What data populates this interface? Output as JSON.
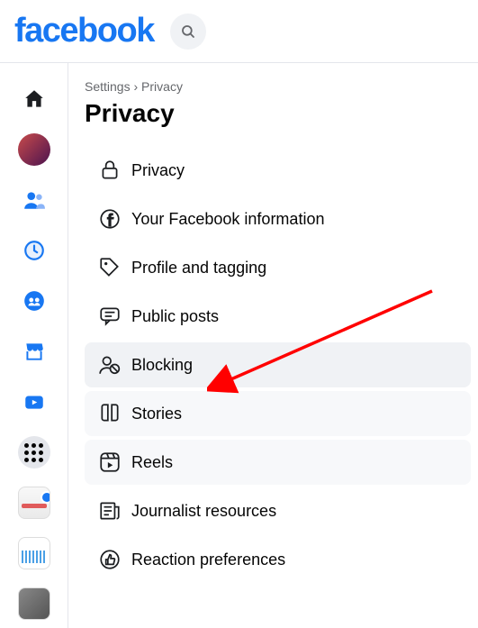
{
  "header": {
    "logo_text": "facebook"
  },
  "breadcrumb": {
    "root": "Settings",
    "sep": "›",
    "current": "Privacy"
  },
  "page": {
    "title": "Privacy"
  },
  "menu": {
    "items": [
      {
        "label": "Privacy"
      },
      {
        "label": "Your Facebook information"
      },
      {
        "label": "Profile and tagging"
      },
      {
        "label": "Public posts"
      },
      {
        "label": "Blocking"
      },
      {
        "label": "Stories"
      },
      {
        "label": "Reels"
      },
      {
        "label": "Journalist resources"
      },
      {
        "label": "Reaction preferences"
      }
    ]
  },
  "colors": {
    "brand": "#1877f2",
    "arrow": "#ff0000"
  }
}
